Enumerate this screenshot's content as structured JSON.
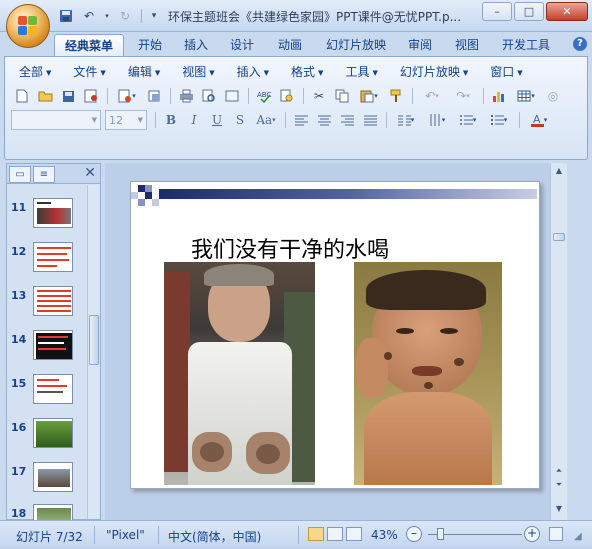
{
  "titlebar": {
    "title": "环保主题班会《共建绿色家园》PPT课件@无忧PPT.p...",
    "qat": [
      "save-icon",
      "undo-icon",
      "redo-icon",
      "customize-icon"
    ],
    "window_buttons": [
      "–",
      "□",
      "✕"
    ]
  },
  "tabs": [
    "经典菜单",
    "开始",
    "插入",
    "设计",
    "动画",
    "幻灯片放映",
    "审阅",
    "视图",
    "开发工具"
  ],
  "active_tab": "经典菜单",
  "help_label": "?",
  "menu": [
    "全部",
    "文件",
    "编辑",
    "视图",
    "插入",
    "格式",
    "工具",
    "幻灯片放映",
    "窗口"
  ],
  "font": {
    "name": "",
    "size": "12"
  },
  "format_buttons": [
    "B",
    "I",
    "U",
    "S",
    "Aa"
  ],
  "slides": [
    {
      "num": "11"
    },
    {
      "num": "12"
    },
    {
      "num": "13"
    },
    {
      "num": "14"
    },
    {
      "num": "15"
    },
    {
      "num": "16"
    },
    {
      "num": "17"
    },
    {
      "num": "18"
    }
  ],
  "slide": {
    "title": "我们没有干净的水喝"
  },
  "status": {
    "slide_info": "幻灯片 7/32",
    "theme": "\"Pixel\"",
    "language": "中文(简体，中国)",
    "zoom": "43%",
    "zoom_minus": "–",
    "zoom_plus": "+"
  }
}
